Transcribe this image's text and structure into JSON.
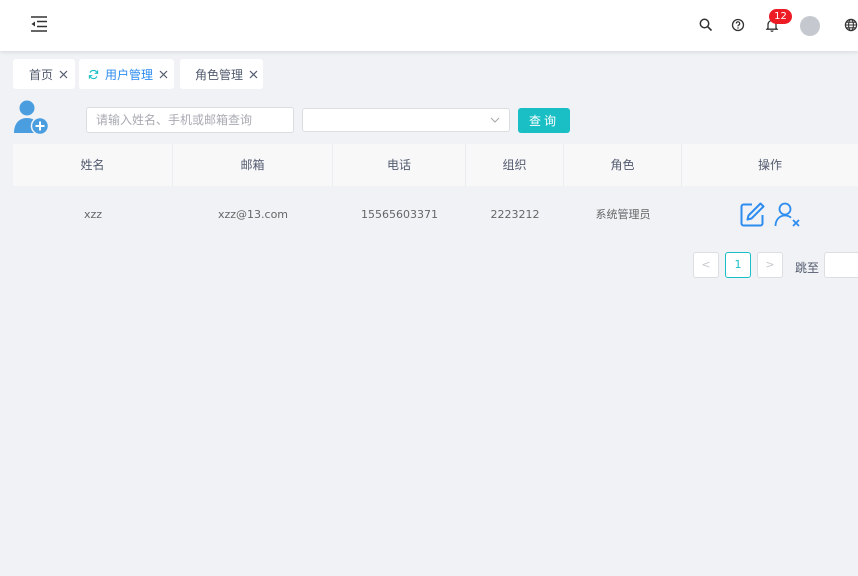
{
  "header": {
    "notification_count": "12",
    "icons": [
      "menu-fold-icon",
      "search-icon",
      "help-icon",
      "bell-icon",
      "avatar",
      "globe-icon"
    ]
  },
  "tabs": [
    {
      "label": "首页",
      "active": false
    },
    {
      "label": "用户管理",
      "active": true
    },
    {
      "label": "角色管理",
      "active": false
    }
  ],
  "toolbar": {
    "search_placeholder": "请输入姓名、手机或邮箱查询",
    "select_value": "",
    "query_label": "查询"
  },
  "table": {
    "columns": [
      "姓名",
      "邮箱",
      "电话",
      "组织",
      "角色",
      "操作"
    ],
    "rows": [
      {
        "name": "xzz",
        "email": "xzz@13.com",
        "phone": "15565603371",
        "org": "2223212",
        "role": "系统管理员"
      }
    ]
  },
  "pagination": {
    "prev": "<",
    "current_page": "1",
    "next": ">",
    "jump_label": "跳至"
  },
  "colors": {
    "accent": "#19bfc5",
    "icon_blue": "#2d8cf0",
    "badge_red": "#ed1c24",
    "header_bg": "#ffffff",
    "page_bg": "#f0f2f5"
  }
}
